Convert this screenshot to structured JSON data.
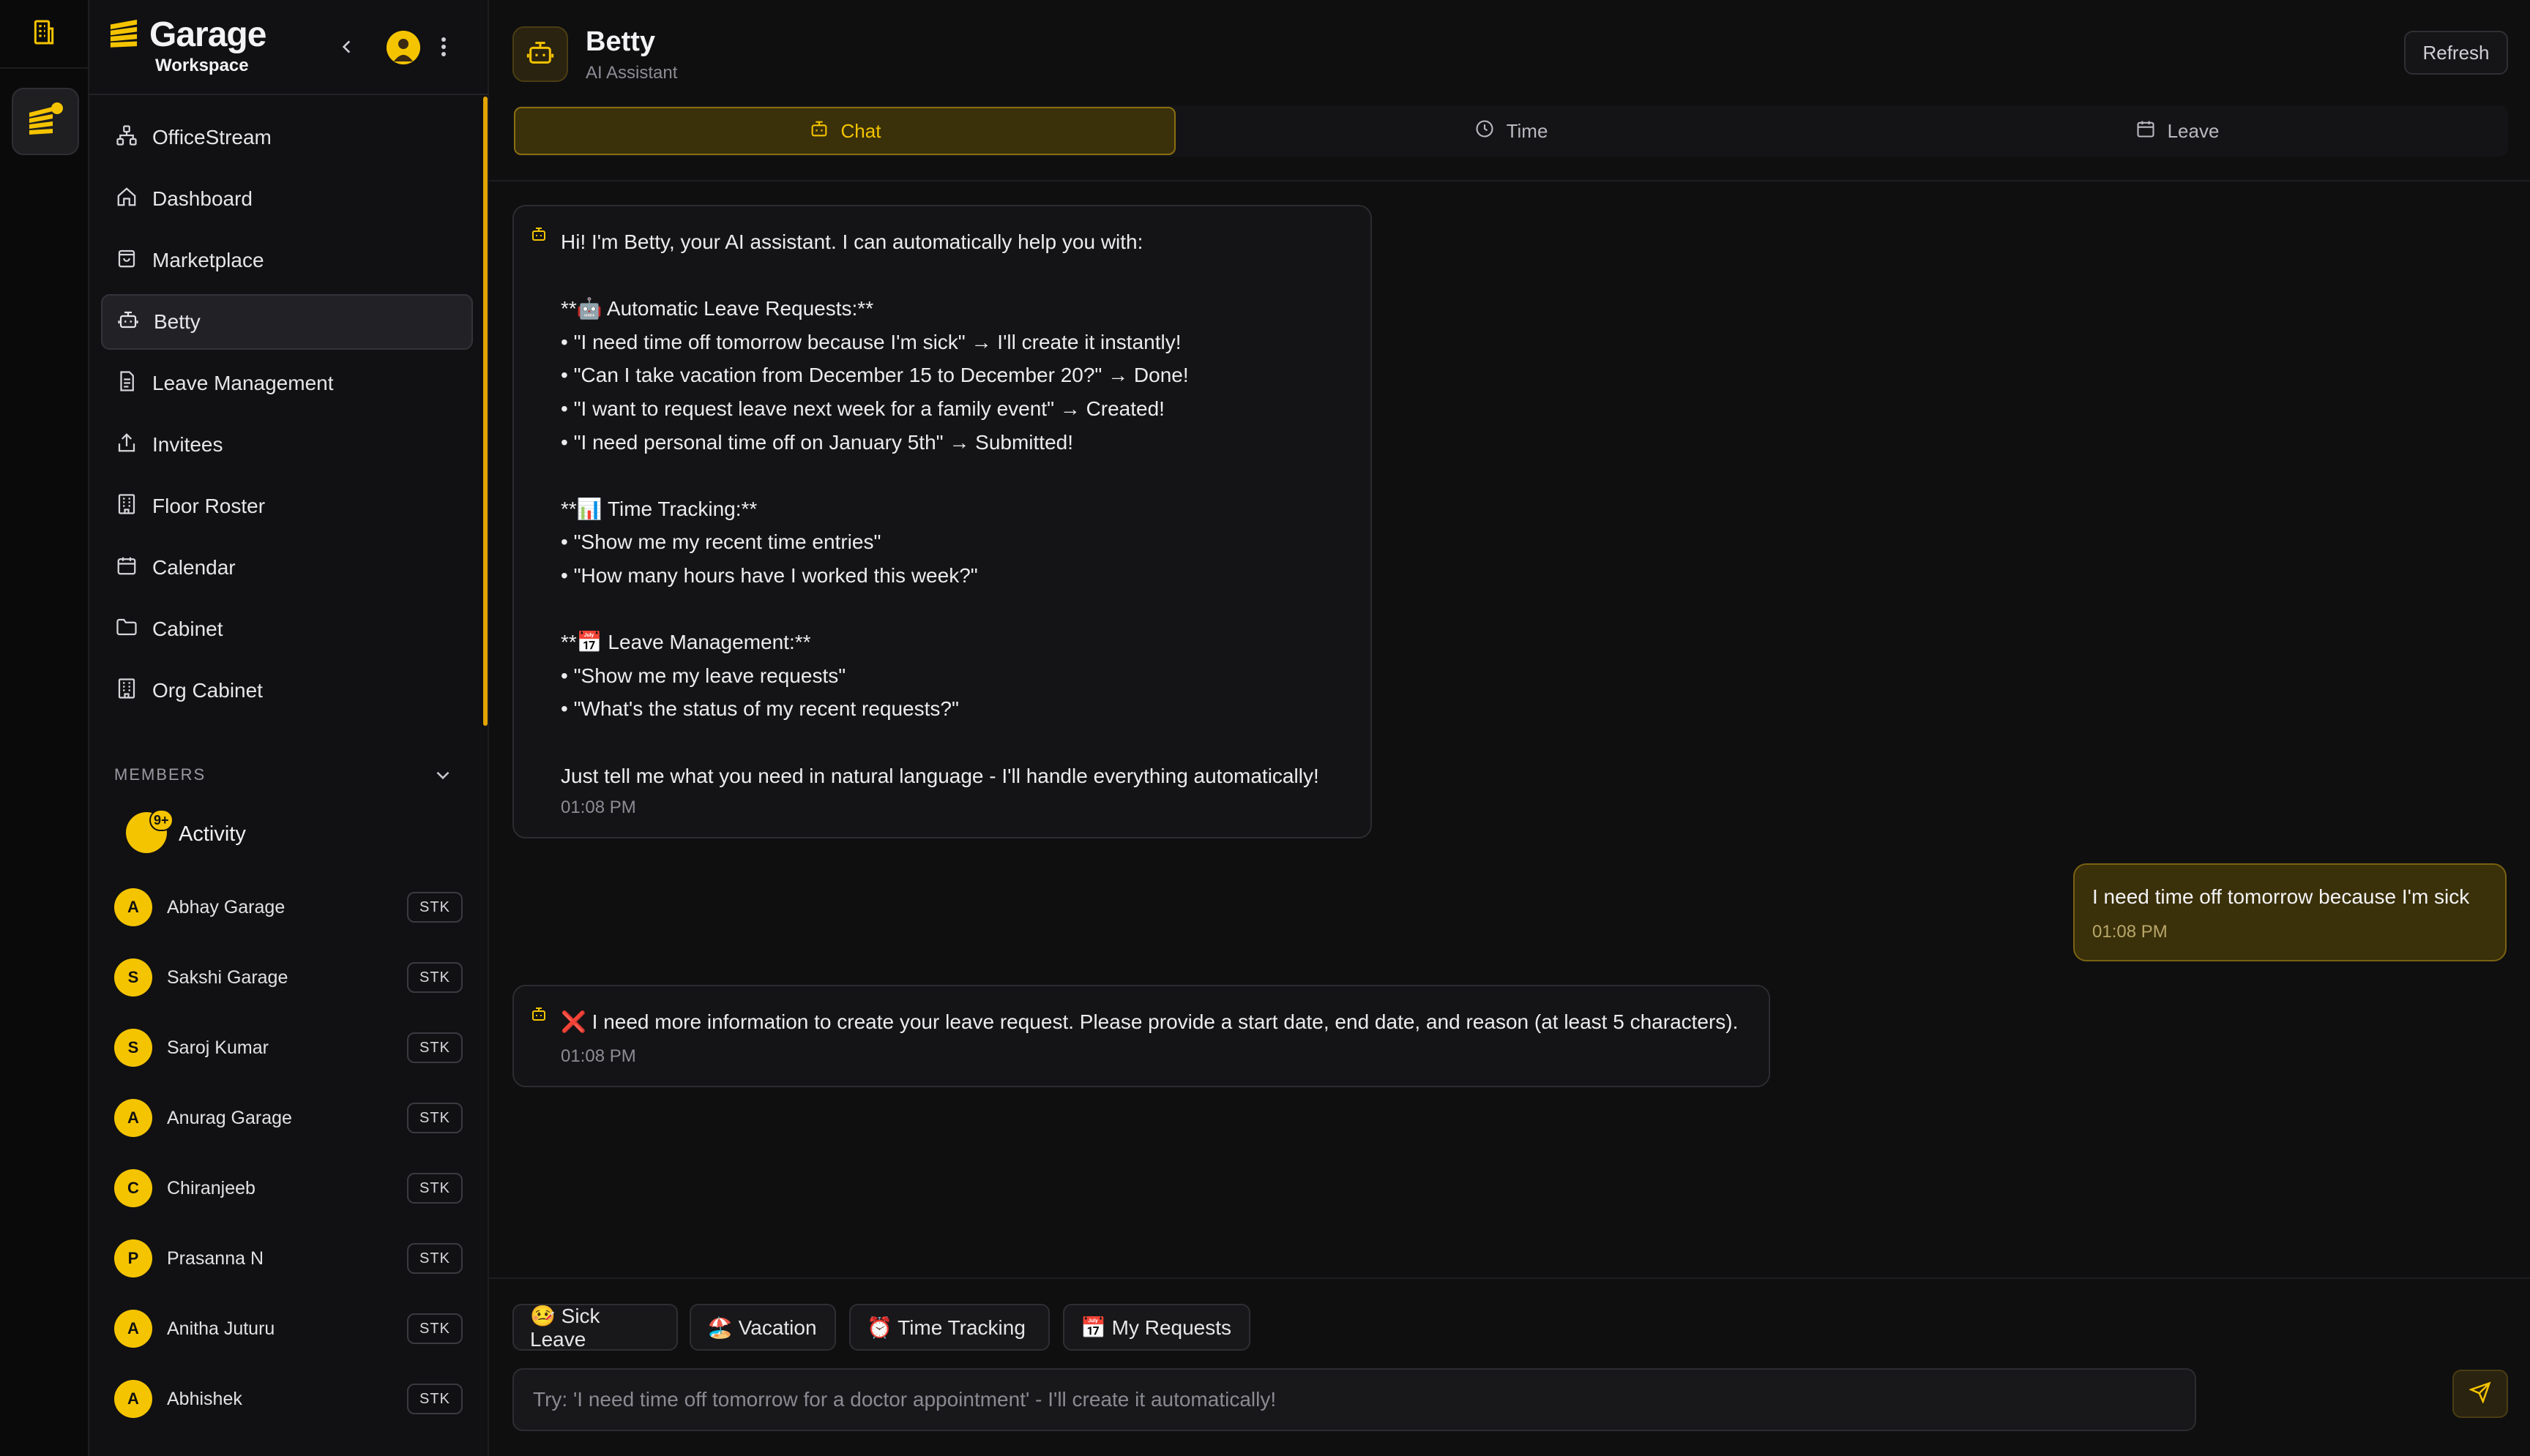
{
  "colors": {
    "accent": "#f5c400",
    "background": "#0f0f10",
    "sidebar": "#111113"
  },
  "brand": {
    "title": "Garage",
    "subtitle": "Workspace"
  },
  "nav": [
    {
      "label": "OfficeStream",
      "icon": "network-icon"
    },
    {
      "label": "Dashboard",
      "icon": "home-icon"
    },
    {
      "label": "Marketplace",
      "icon": "shopping-bag-icon"
    },
    {
      "label": "Betty",
      "icon": "bot-icon",
      "active": true
    },
    {
      "label": "Leave Management",
      "icon": "document-icon"
    },
    {
      "label": "Invitees",
      "icon": "share-icon"
    },
    {
      "label": "Floor Roster",
      "icon": "building-icon"
    },
    {
      "label": "Calendar",
      "icon": "calendar-icon"
    },
    {
      "label": "Cabinet",
      "icon": "folder-icon"
    },
    {
      "label": "Org Cabinet",
      "icon": "building-icon"
    }
  ],
  "members": {
    "heading": "MEMBERS",
    "activity_label": "Activity",
    "activity_badge": "9+",
    "list": [
      {
        "initial": "A",
        "name": "Abhay Garage",
        "tag": "STK"
      },
      {
        "initial": "S",
        "name": "Sakshi Garage",
        "tag": "STK"
      },
      {
        "initial": "S",
        "name": "Saroj Kumar",
        "tag": "STK"
      },
      {
        "initial": "A",
        "name": "Anurag Garage",
        "tag": "STK"
      },
      {
        "initial": "C",
        "name": "Chiranjeeb",
        "tag": "STK"
      },
      {
        "initial": "P",
        "name": "Prasanna N",
        "tag": "STK"
      },
      {
        "initial": "A",
        "name": "Anitha Juturu",
        "tag": "STK"
      },
      {
        "initial": "A",
        "name": "Abhishek",
        "tag": "STK"
      }
    ]
  },
  "header": {
    "title": "Betty",
    "subtitle": "AI Assistant",
    "refresh_label": "Refresh"
  },
  "tabs": [
    {
      "label": "Chat",
      "icon": "bot-icon",
      "active": true
    },
    {
      "label": "Time",
      "icon": "clock-icon"
    },
    {
      "label": "Leave",
      "icon": "calendar-icon"
    }
  ],
  "messages": [
    {
      "from": "bot",
      "text": "Hi! I'm Betty, your AI assistant. I can automatically help you with:\n\n**🤖 Automatic Leave Requests:**\n• \"I need time off tomorrow because I'm sick\" → I'll create it instantly!\n• \"Can I take vacation from December 15 to December 20?\" → Done!\n• \"I want to request leave next week for a family event\" → Created!\n• \"I need personal time off on January 5th\" → Submitted!\n\n**📊 Time Tracking:**\n• \"Show me my recent time entries\"\n• \"How many hours have I worked this week?\"\n\n**📅 Leave Management:**\n• \"Show me my leave requests\"\n• \"What's the status of my recent requests?\"\n\nJust tell me what you need in natural language - I'll handle everything automatically!",
      "time": "01:08 PM"
    },
    {
      "from": "user",
      "text": "I need time off tomorrow because I'm sick",
      "time": "01:08 PM"
    },
    {
      "from": "bot",
      "text": "❌ I need more information to create your leave request. Please provide a start date, end date, and reason (at least 5 characters).",
      "time": "01:08 PM"
    }
  ],
  "quick_actions": [
    {
      "label": "🤒 Sick Leave"
    },
    {
      "label": "🏖️ Vacation"
    },
    {
      "label": "⏰ Time Tracking"
    },
    {
      "label": "📅 My Requests"
    }
  ],
  "input": {
    "placeholder": "Try: 'I need time off tomorrow for a doctor appointment' - I'll create it automatically!"
  }
}
